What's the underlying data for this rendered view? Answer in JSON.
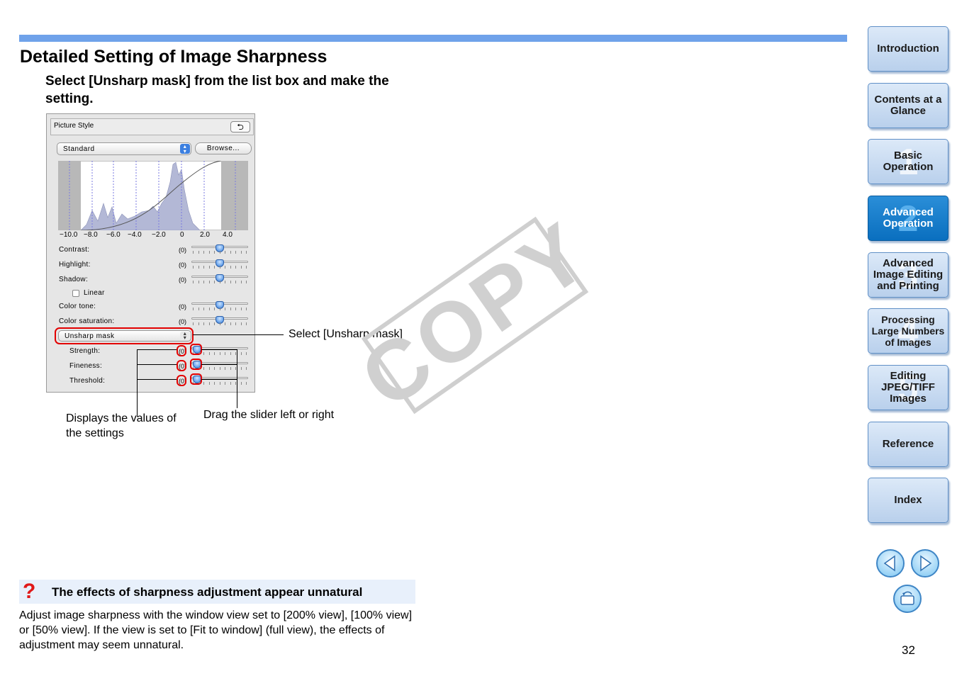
{
  "page": {
    "title": "Detailed Setting of Image Sharpness",
    "step": "Select [Unsharp mask] from the list box and make the setting.",
    "page_number": "32"
  },
  "panel": {
    "header": "Picture Style",
    "style_value": "Standard",
    "browse_label": "Browse...",
    "ticks": [
      "−10.0",
      "−8.0",
      "−6.0",
      "−4.0",
      "−2.0",
      "0",
      "2.0",
      "4.0"
    ],
    "rows": [
      {
        "label": "Contrast:",
        "value": "(0)"
      },
      {
        "label": "Highlight:",
        "value": "(0)"
      },
      {
        "label": "Shadow:",
        "value": "(0)"
      },
      {
        "label": "Color tone:",
        "value": "(0)"
      },
      {
        "label": "Color saturation:",
        "value": "(0)"
      }
    ],
    "linear_label": "Linear",
    "sharpness_select": "Unsharp mask",
    "sharp_rows": [
      {
        "label": "Strength:",
        "value": "(0)"
      },
      {
        "label": "Fineness:",
        "value": "(0)"
      },
      {
        "label": "Threshold:",
        "value": "(0)"
      }
    ]
  },
  "callouts": {
    "select": "Select [Unsharp mask]",
    "values": "Displays the values of the settings",
    "drag": "Drag the slider left or right"
  },
  "watermark": "COPY",
  "note": {
    "title": "The effects of sharpness adjustment appear unnatural",
    "text": "Adjust image sharpness with the window view set to [200% view], [100% view] or [50% view]. If the view is set to [Fit to window] (full view), the effects of adjustment may seem unnatural."
  },
  "nav": [
    {
      "label": "Introduction",
      "num": ""
    },
    {
      "label": "Contents at a Glance",
      "num": ""
    },
    {
      "label": "Basic Operation",
      "num": "1"
    },
    {
      "label": "Advanced Operation",
      "num": "2",
      "active": true
    },
    {
      "label": "Advanced Image Editing and Printing",
      "num": "3"
    },
    {
      "label": "Processing Large Numbers of Images",
      "num": "4"
    },
    {
      "label": "Editing JPEG/TIFF Images",
      "num": "5"
    },
    {
      "label": "Reference",
      "num": ""
    },
    {
      "label": "Index",
      "num": ""
    }
  ],
  "colors": {
    "accent": "#6fa2ea",
    "highlight": "#e20000",
    "nav_active": "#0a6fbf"
  }
}
